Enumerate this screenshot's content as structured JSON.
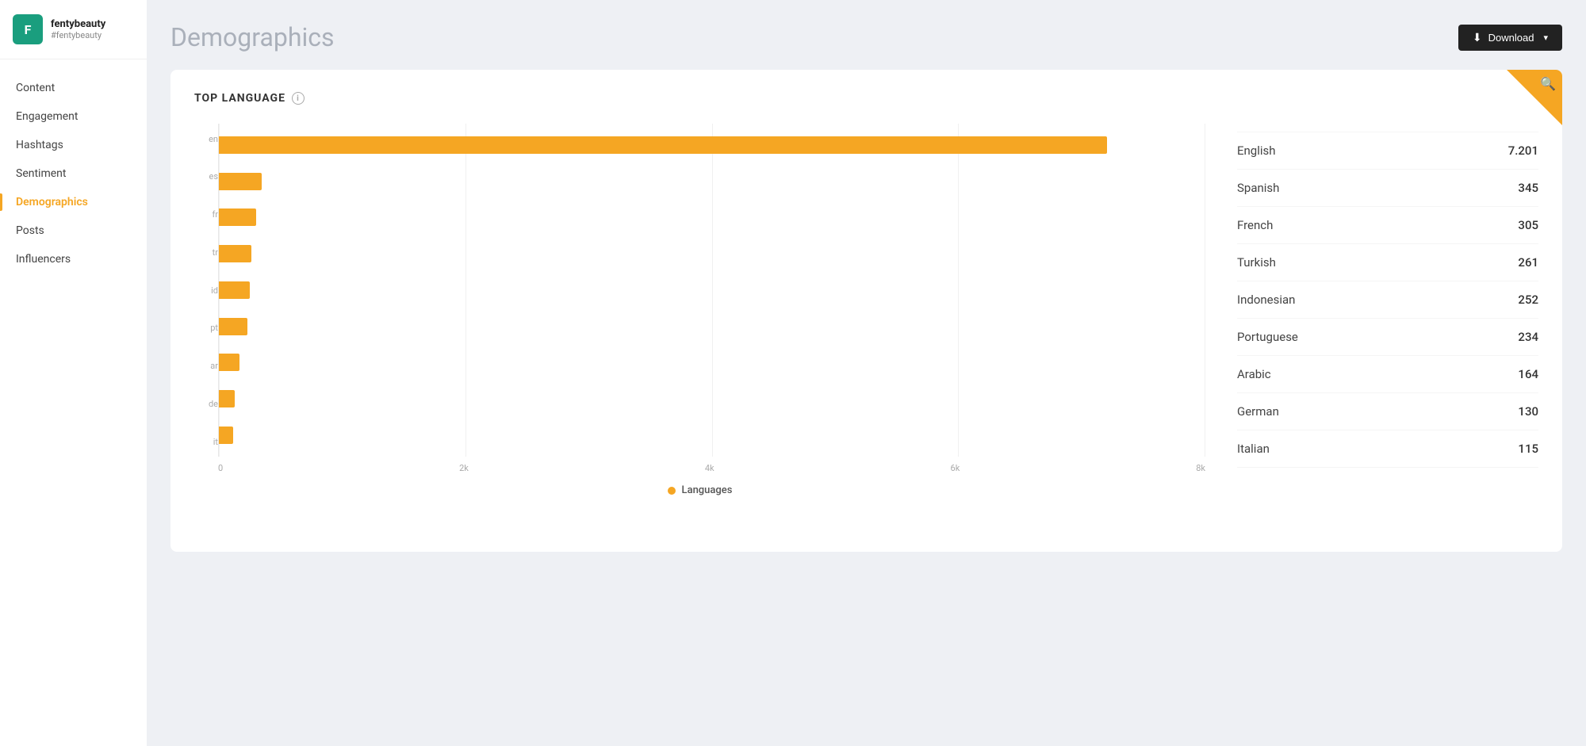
{
  "brand": {
    "initial": "F",
    "name": "fentybeauty",
    "handle": "#fentybeauty"
  },
  "nav": {
    "items": [
      {
        "id": "content",
        "label": "Content",
        "active": false
      },
      {
        "id": "engagement",
        "label": "Engagement",
        "active": false
      },
      {
        "id": "hashtags",
        "label": "Hashtags",
        "active": false
      },
      {
        "id": "sentiment",
        "label": "Sentiment",
        "active": false
      },
      {
        "id": "demographics",
        "label": "Demographics",
        "active": true
      },
      {
        "id": "posts",
        "label": "Posts",
        "active": false
      },
      {
        "id": "influencers",
        "label": "Influencers",
        "active": false
      }
    ]
  },
  "header": {
    "title": "Demographics",
    "download_label": "Download"
  },
  "card": {
    "section_title": "TOP LANGUAGE",
    "legend_label": "Languages"
  },
  "chart": {
    "max_value": 8000,
    "x_labels": [
      "0",
      "2k",
      "4k",
      "6k",
      "8k"
    ],
    "bars": [
      {
        "code": "en",
        "value": 7201,
        "pct": 90.0
      },
      {
        "code": "es",
        "value": 345,
        "pct": 4.3
      },
      {
        "code": "fr",
        "value": 305,
        "pct": 3.8
      },
      {
        "code": "tr",
        "value": 261,
        "pct": 3.3
      },
      {
        "code": "id",
        "value": 252,
        "pct": 3.2
      },
      {
        "code": "pt",
        "value": 234,
        "pct": 2.9
      },
      {
        "code": "ar",
        "value": 164,
        "pct": 2.1
      },
      {
        "code": "de",
        "value": 130,
        "pct": 1.6
      },
      {
        "code": "it",
        "value": 115,
        "pct": 1.4
      }
    ]
  },
  "stats": [
    {
      "language": "English",
      "value": "7.201"
    },
    {
      "language": "Spanish",
      "value": "345"
    },
    {
      "language": "French",
      "value": "305"
    },
    {
      "language": "Turkish",
      "value": "261"
    },
    {
      "language": "Indonesian",
      "value": "252"
    },
    {
      "language": "Portuguese",
      "value": "234"
    },
    {
      "language": "Arabic",
      "value": "164"
    },
    {
      "language": "German",
      "value": "130"
    },
    {
      "language": "Italian",
      "value": "115"
    }
  ]
}
